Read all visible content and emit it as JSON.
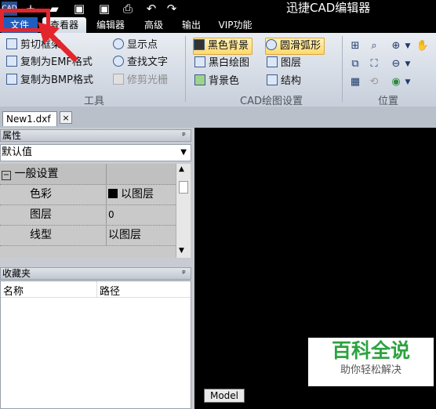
{
  "title_bar": {
    "app_title": "迅捷CAD编辑器",
    "logo_text": "CAD",
    "quick_access_icons": [
      "new-file-icon",
      "open-folder-icon",
      "save-icon",
      "save-as-icon",
      "print-icon",
      "undo-icon",
      "redo-icon"
    ]
  },
  "menu_tabs": [
    {
      "label": "文件"
    },
    {
      "label": "查看器"
    },
    {
      "label": "编辑器"
    },
    {
      "label": "高级"
    },
    {
      "label": "输出"
    },
    {
      "label": "VIP功能"
    }
  ],
  "ribbon": {
    "tools_group": {
      "label": "工具",
      "items": [
        "剪切框架",
        "复制为EMF格式",
        "复制为BMP格式",
        "显示点",
        "查找文字",
        "修剪光栅"
      ]
    },
    "cad_settings_group": {
      "label": "CAD绘图设置",
      "items": [
        "黑色背景",
        "圆滑弧形",
        "黑白绘图",
        "图层",
        "背景色",
        "结构"
      ]
    },
    "position_group": {
      "label": "位置"
    }
  },
  "document_tab": {
    "label": "New1.dxf",
    "close_glyph": "×"
  },
  "properties_panel": {
    "header": "属性",
    "pin_glyph": "ᵖ",
    "combo_value": "默认值",
    "category": {
      "toggle": "−",
      "label": "一般设置"
    },
    "rows": [
      {
        "name": "色彩",
        "value": "以图层"
      },
      {
        "name": "图层",
        "value": "0"
      },
      {
        "name": "线型",
        "value": "以图层"
      }
    ]
  },
  "favorites_panel": {
    "header": "收藏夹",
    "columns": [
      "名称",
      "路径"
    ]
  },
  "canvas": {
    "model_tab": "Model",
    "watermark": {
      "main": "百科全说",
      "sub": "助你轻松解决"
    }
  }
}
